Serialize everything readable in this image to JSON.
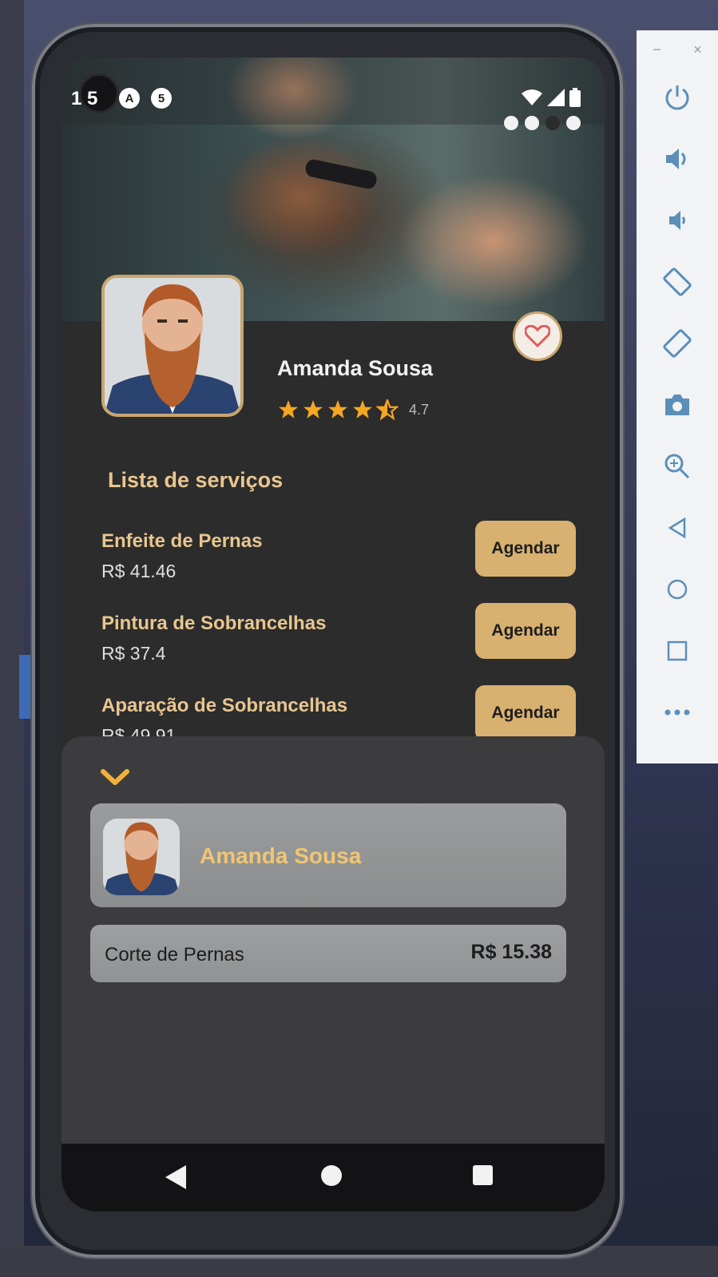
{
  "status_bar": {
    "time": "1 5",
    "icon_a": "A",
    "icon_b": "5"
  },
  "barber": {
    "name": "Amanda Sousa",
    "rating": "4.7",
    "rating_stars": 4.5
  },
  "services_title": "Lista de serviços",
  "services": [
    {
      "name": "Enfeite de Pernas",
      "price": "R$ 41.46",
      "action": "Agendar"
    },
    {
      "name": "Pintura de Sobrancelhas",
      "price": "R$ 37.4",
      "action": "Agendar"
    },
    {
      "name": "Aparação de Sobrancelhas",
      "price": "R$ 49.91",
      "action": "Agendar"
    }
  ],
  "booking_sheet": {
    "barber_name": "Amanda Sousa",
    "service_name": "Corte de Pernas",
    "service_price": "R$ 15.38"
  },
  "colors": {
    "accent": "#d8b070",
    "gold_text": "#e8c68f",
    "background": "#2c2c2c",
    "sheet": "#3c3c3e",
    "emulator_icons": "#5b8fb9"
  },
  "emulator_toolbar": {
    "window_controls": [
      "−",
      "×"
    ],
    "buttons": [
      "power-icon",
      "volume-up-icon",
      "volume-down-icon",
      "rotate-left-icon",
      "rotate-right-icon",
      "camera-icon",
      "zoom-icon",
      "back-icon",
      "home-icon",
      "overview-icon",
      "more-icon"
    ]
  }
}
